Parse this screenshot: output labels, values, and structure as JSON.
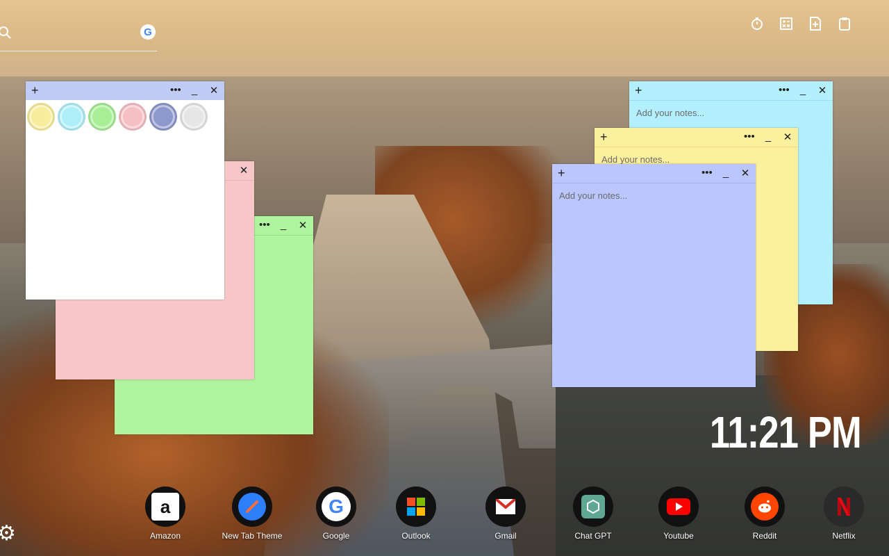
{
  "search": {
    "placeholder": ""
  },
  "tools": [
    {
      "icon": "timer-icon"
    },
    {
      "icon": "calculator-icon"
    },
    {
      "icon": "add-note-icon"
    },
    {
      "icon": "clipboard-icon"
    }
  ],
  "notes": {
    "placeholder": "Add your notes...",
    "add_label": "+",
    "menu_label": "•••",
    "minimize_label": "_",
    "close_label": "✕"
  },
  "swatch_colors": [
    "#f7ed9c",
    "#aeeef9",
    "#a7ee95",
    "#f6bfc4",
    "#8d98cc",
    "#e6e6e6"
  ],
  "clock": {
    "time": "11:21 PM"
  },
  "dock": [
    {
      "label": "Amazon",
      "icon": "amazon-icon"
    },
    {
      "label": "New Tab Theme",
      "icon": "new-tab-theme-icon"
    },
    {
      "label": "Google",
      "icon": "google-icon"
    },
    {
      "label": "Outlook",
      "icon": "outlook-icon"
    },
    {
      "label": "Gmail",
      "icon": "gmail-icon"
    },
    {
      "label": "Chat GPT",
      "icon": "chatgpt-icon"
    },
    {
      "label": "Youtube",
      "icon": "youtube-icon"
    },
    {
      "label": "Reddit",
      "icon": "reddit-icon"
    },
    {
      "label": "Netflix",
      "icon": "netflix-icon"
    }
  ]
}
